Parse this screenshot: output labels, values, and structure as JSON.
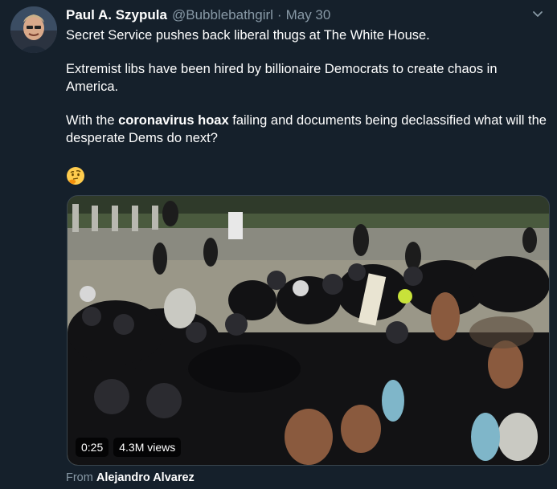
{
  "author": {
    "display_name": "Paul A. Szypula",
    "handle": "@Bubblebathgirl",
    "separator": "·",
    "date": "May 30"
  },
  "tweet": {
    "paragraph_1": "Secret Service pushes back liberal thugs at The White House.",
    "paragraph_2": "Extremist libs have been hired by billionaire Democrats to create chaos in America.",
    "paragraph_3_pre": "With the ",
    "paragraph_3_bold": "coronavirus hoax",
    "paragraph_3_post": " failing and documents being declassified what will the desperate Dems do next?",
    "emoji": "thinking-face-emoji"
  },
  "video": {
    "duration": "0:25",
    "views": "4.3M views"
  },
  "attribution": {
    "label": "From",
    "source": "Alejandro Alvarez"
  },
  "colors": {
    "background": "#15202b",
    "secondary_text": "#8899a6",
    "border": "#38444d"
  }
}
